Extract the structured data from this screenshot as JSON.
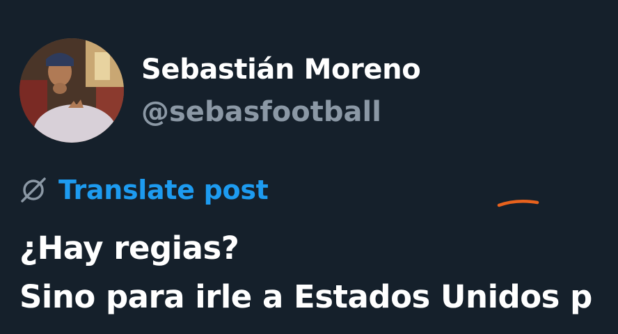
{
  "post": {
    "author": {
      "name": "Sebastián Moreno",
      "handle": "@sebasfootball"
    },
    "translate_label": "Translate post",
    "text_lines": [
      "¿Hay regias?",
      "Sino para irle a Estados Unidos p"
    ]
  },
  "icons": {
    "translate": "translate-globe-icon",
    "avatar": "user-avatar-photo"
  },
  "colors": {
    "background": "#15202b",
    "name": "#ffffff",
    "handle": "#8b98a5",
    "link": "#1d9bf0",
    "annotation": "#e8621d"
  }
}
